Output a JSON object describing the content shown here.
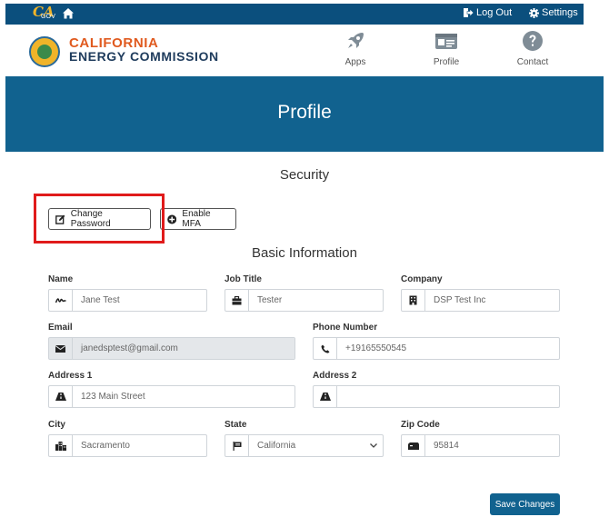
{
  "topbar": {
    "gov_logo_text": "CA.GOV",
    "logout_label": "Log Out",
    "settings_label": "Settings"
  },
  "header": {
    "brand_line1": "CALIFORNIA",
    "brand_line2": "ENERGY COMMISSION",
    "nav": [
      {
        "label": "Apps",
        "icon": "rocket-icon"
      },
      {
        "label": "Profile",
        "icon": "id-card-icon"
      },
      {
        "label": "Contact",
        "icon": "question-circle-icon"
      }
    ]
  },
  "banner": {
    "title": "Profile"
  },
  "security": {
    "title": "Security",
    "change_password_label": "Change Password",
    "enable_mfa_label": "Enable MFA"
  },
  "basic": {
    "title": "Basic Information",
    "name": {
      "label": "Name",
      "value": "Jane Test"
    },
    "job_title": {
      "label": "Job Title",
      "value": "Tester"
    },
    "company": {
      "label": "Company",
      "value": "DSP Test Inc"
    },
    "email": {
      "label": "Email",
      "value": "janedsptest@gmail.com"
    },
    "phone": {
      "label": "Phone Number",
      "value": "+19165550545"
    },
    "address1": {
      "label": "Address 1",
      "value": "123 Main Street"
    },
    "address2": {
      "label": "Address 2",
      "value": ""
    },
    "city": {
      "label": "City",
      "value": "Sacramento"
    },
    "state": {
      "label": "State",
      "value": "California"
    },
    "zip": {
      "label": "Zip Code",
      "value": "95814"
    }
  },
  "save_label": "Save Changes",
  "colors": {
    "topbar": "#0b4f7d",
    "banner": "#11628f",
    "brand_orange": "#e05a1f",
    "brand_navy": "#1e3b5c",
    "highlight_red": "#e01b1b"
  }
}
